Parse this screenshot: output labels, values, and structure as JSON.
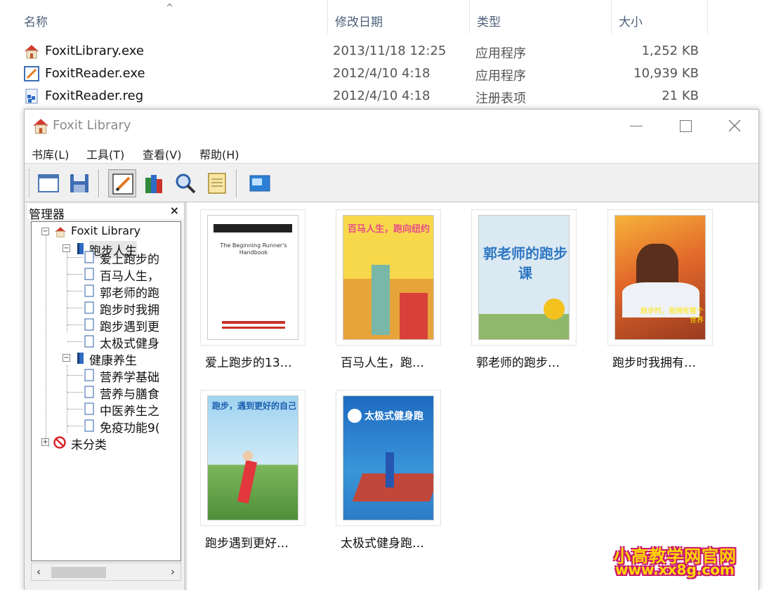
{
  "explorer": {
    "columns": {
      "name": "名称",
      "modified": "修改日期",
      "type": "类型",
      "size": "大小"
    },
    "sort_indicator": "^",
    "files": [
      {
        "name": "FoxitLibrary.exe",
        "modified": "2013/11/18 12:25",
        "type": "应用程序",
        "size": "1,252 KB",
        "icon": "foxit-library-house-icon"
      },
      {
        "name": "FoxitReader.exe",
        "modified": "2012/4/10 4:18",
        "type": "应用程序",
        "size": "10,939 KB",
        "icon": "foxit-reader-pen-icon"
      },
      {
        "name": "FoxitReader.reg",
        "modified": "2012/4/10 4:18",
        "type": "注册表项",
        "size": "21 KB",
        "icon": "registry-file-icon"
      }
    ]
  },
  "window": {
    "title": "Foxit Library",
    "menu": [
      "书库(L)",
      "工具(T)",
      "查看(V)",
      "帮助(H)"
    ],
    "toolbar_icons": [
      "new-window-icon",
      "save-icon",
      "edit-pen-icon",
      "books-icon",
      "search-icon",
      "notes-icon",
      "screen-icon"
    ],
    "manager": {
      "title": "管理器",
      "close_glyph": "×",
      "tree": {
        "root": "Foxit Library",
        "groups": [
          {
            "name": "跑步人生",
            "items": [
              "爱上跑步的",
              "百马人生，",
              "郭老师的跑",
              "跑步时我拥",
              "跑步遇到更",
              "太极式健身"
            ]
          },
          {
            "name": "健康养生",
            "items": [
              "营养学基础",
              "营养与膳食",
              "中医养生之",
              "免疫功能9("
            ]
          }
        ],
        "uncategorized": "未分类"
      }
    },
    "books": [
      {
        "title": "爱上跑步的13…",
        "cover_text": "The Beginning Runner's Handbook"
      },
      {
        "title": "百马人生，跑…",
        "cover_text": "百马人生，跑向纽约"
      },
      {
        "title": "郭老师的跑步…",
        "cover_text": "郭老师的跑步课"
      },
      {
        "title": "跑步时我拥有…",
        "cover_text": "跑步时，我拥有整个世界"
      },
      {
        "title": "跑步遇到更好…",
        "cover_text": "跑步，遇到更好的自己"
      },
      {
        "title": "太极式健身跑…",
        "cover_text": "太极式健身跑"
      }
    ]
  },
  "watermark": {
    "line1": "小高教学网官网",
    "line2": "www.xx8g.com"
  },
  "colors": {
    "header_text": "#4c607a",
    "accent_red": "#d23b2f",
    "watermark_yellow": "#ffd800",
    "watermark_pink": "#c9186b"
  }
}
